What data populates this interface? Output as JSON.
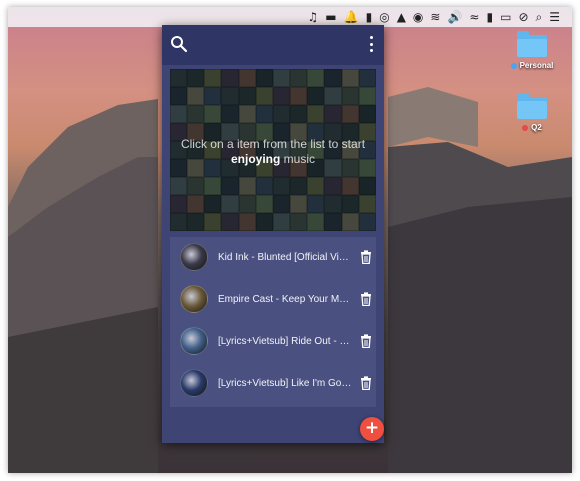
{
  "menubar": {
    "icons": [
      "music-icon",
      "folder-icon",
      "bell-icon",
      "truck-icon",
      "glasses-icon",
      "hat-icon",
      "disk-icon",
      "wifi-broadcast-icon",
      "volume-icon",
      "wifi-icon",
      "flag-fr-icon",
      "battery-icon",
      "compass-icon",
      "spotlight-icon",
      "notification-list-icon"
    ],
    "glyphs": [
      "♫",
      "▬",
      "🔔",
      "▮",
      "◎",
      "▲",
      "◉",
      "≋",
      "🔊",
      "≈",
      "▮",
      "▭",
      "⊘",
      "⌕",
      "☰"
    ]
  },
  "desktop": {
    "items": [
      {
        "label": "Personal",
        "tag_color": "#4aa3f0"
      },
      {
        "label": "Q2",
        "tag_color": "#e34b4b"
      }
    ]
  },
  "app": {
    "hint_line1": "Click on a item from the list to start",
    "hint_bold": "enjoying",
    "hint_rest": "music",
    "tracks": [
      {
        "title": "Kid Ink - Blunted [Official Vi…",
        "thumb_color": "#3a3a4a"
      },
      {
        "title": "Empire Cast - Keep Your M…",
        "thumb_color": "#6b5a3a"
      },
      {
        "title": "[Lyrics+Vietsub] Ride Out - …",
        "thumb_color": "#41608a"
      },
      {
        "title": "[Lyrics+Vietsub] Like I'm Go…",
        "thumb_color": "#2a3a6a"
      }
    ],
    "fab_label": "+",
    "colors": {
      "panel": "#3e4473",
      "header": "#2f3565",
      "list": "#4a5180",
      "fab": "#ef4f3f"
    }
  }
}
